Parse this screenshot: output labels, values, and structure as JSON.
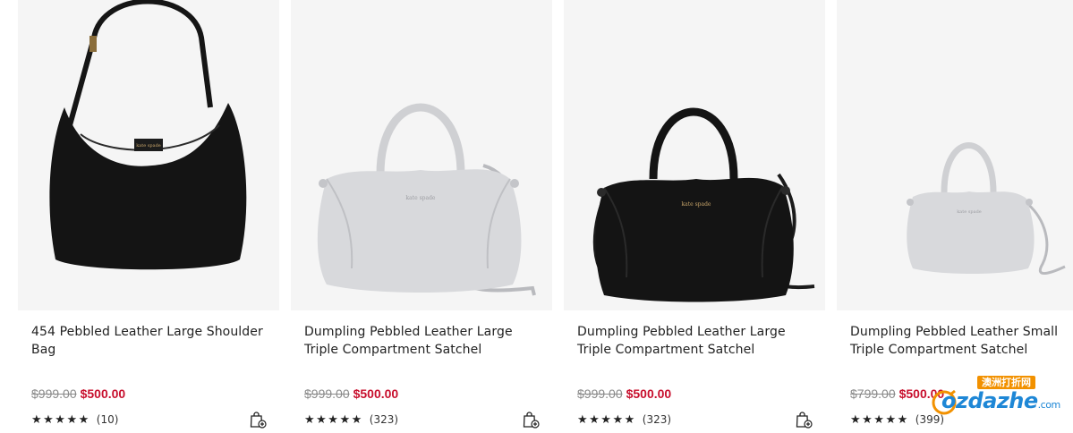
{
  "products": [
    {
      "title": "454 Pebbled Leather Large Shoulder Bag",
      "original_price": "$999.00",
      "sale_price": "$500.00",
      "stars": "★★★★★",
      "review_count": "(10)",
      "bag_color": "black",
      "style": "hobo"
    },
    {
      "title": "Dumpling Pebbled Leather Large Triple Compartment Satchel",
      "original_price": "$999.00",
      "sale_price": "$500.00",
      "stars": "★★★★★",
      "review_count": "(323)",
      "bag_color": "light gray",
      "style": "satchel-large"
    },
    {
      "title": "Dumpling Pebbled Leather Large Triple Compartment Satchel",
      "original_price": "$999.00",
      "sale_price": "$500.00",
      "stars": "★★★★★",
      "review_count": "(323)",
      "bag_color": "black",
      "style": "satchel-large"
    },
    {
      "title": "Dumpling Pebbled Leather Small Triple Compartment Satchel",
      "original_price": "$799.00",
      "sale_price": "$500.00",
      "stars": "★★★★★",
      "review_count": "(399)",
      "bag_color": "light gray",
      "style": "satchel-small"
    }
  ],
  "bag_brand_text": "kate spade",
  "colors": {
    "sale_price": "#c8102e",
    "original_price": "#8a8a8a",
    "image_background": "#f5f5f5",
    "black_leather": "#141414",
    "gray_leather": "#d8d9dc"
  },
  "icons": {
    "add_to_bag": "shopping-bag-plus-icon",
    "rating": "star-icon"
  },
  "watermark": {
    "cn_label": "澳洲打折网",
    "site": "ozdazhe",
    "tld": ".com"
  }
}
